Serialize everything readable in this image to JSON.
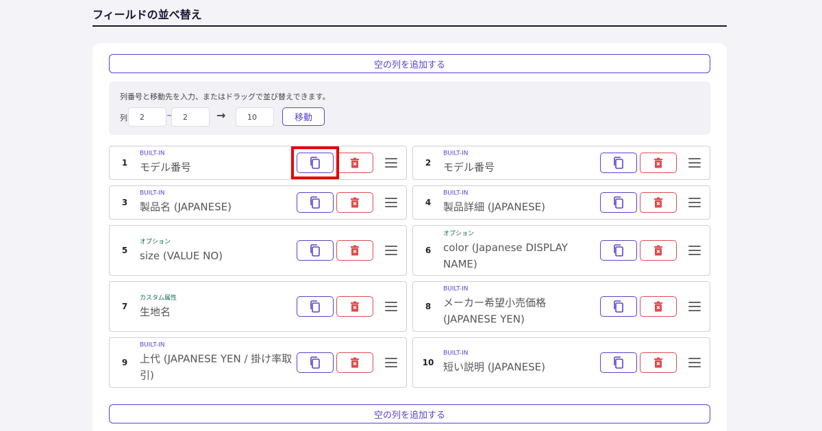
{
  "heading": {
    "title": "フィールドの並べ替え"
  },
  "actions": {
    "add_empty_column": "空の列を追加する"
  },
  "move_panel": {
    "hint": "列番号と移動先を入力、またはドラッグで並び替えできます。",
    "column_label": "列",
    "range_separator": "~",
    "arrow": "→",
    "from_value": "2",
    "to_value": "2",
    "target_value": "10",
    "move_button": "移動"
  },
  "fields": [
    {
      "number": "1",
      "tag": "BUILT-IN",
      "tag_kind": "builtin",
      "name": "モデル番号"
    },
    {
      "number": "2",
      "tag": "BUILT-IN",
      "tag_kind": "builtin",
      "name": "モデル番号"
    },
    {
      "number": "3",
      "tag": "BUILT-IN",
      "tag_kind": "builtin",
      "name": "製品名 (JAPANESE)"
    },
    {
      "number": "4",
      "tag": "BUILT-IN",
      "tag_kind": "builtin",
      "name": "製品詳細 (JAPANESE)"
    },
    {
      "number": "5",
      "tag": "オプション",
      "tag_kind": "option",
      "name": "size (VALUE NO)"
    },
    {
      "number": "6",
      "tag": "オプション",
      "tag_kind": "option",
      "name": "color (Japanese DISPLAY NAME)"
    },
    {
      "number": "7",
      "tag": "カスタム属性",
      "tag_kind": "custom",
      "name": "生地名"
    },
    {
      "number": "8",
      "tag": "BUILT-IN",
      "tag_kind": "builtin",
      "name": "メーカー希望小売価格 (JAPANESE YEN)"
    },
    {
      "number": "9",
      "tag": "BUILT-IN",
      "tag_kind": "builtin",
      "name": "上代 (JAPANESE YEN / 掛け率取引)"
    },
    {
      "number": "10",
      "tag": "BUILT-IN",
      "tag_kind": "builtin",
      "name": "短い説明 (JAPANESE)"
    }
  ],
  "icons": {
    "copy": "copy-icon",
    "delete": "trash-icon",
    "drag": "drag-handle-icon"
  },
  "colors": {
    "accent": "#5b3fd0",
    "danger": "#e04a4a",
    "option_tag": "#0d6b55",
    "highlight": "#e60000"
  }
}
